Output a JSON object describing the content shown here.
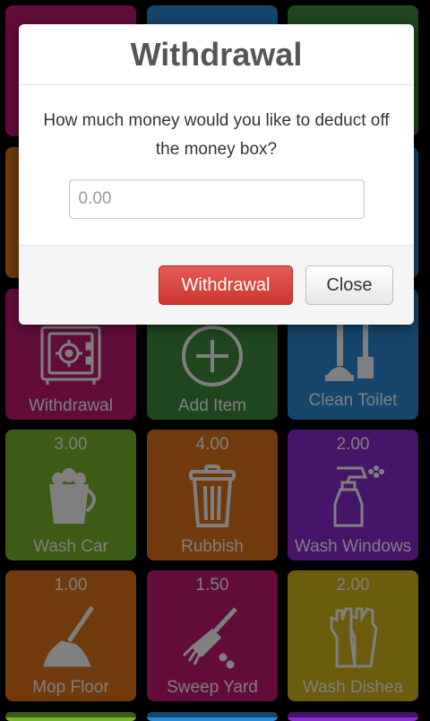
{
  "tiles": [
    {
      "price": "",
      "label": "",
      "color": "#c41979"
    },
    {
      "price": "",
      "label": "",
      "color": "#2a8bd6"
    },
    {
      "price": "",
      "label": "",
      "color": "#3e8c3a"
    },
    {
      "price": "",
      "label": "",
      "color": "#e2741a"
    },
    {
      "price": "",
      "label": "",
      "color": "#1b7e94"
    },
    {
      "price": "",
      "label": "",
      "color": "#2a8bd6"
    },
    {
      "price": "",
      "label": "Withdrawal",
      "color": "#c41979",
      "icon": "safe-icon"
    },
    {
      "price": "",
      "label": "Add Item",
      "color": "#3e8c3a",
      "icon": "plus-circle-icon"
    },
    {
      "price": "",
      "label": "Clean Toilet",
      "color": "#2a8bd6",
      "icon": "plunger-brush-icon"
    },
    {
      "price": "3.00",
      "label": "Wash Car",
      "color": "#78b62b",
      "icon": "bucket-icon"
    },
    {
      "price": "4.00",
      "label": "Rubbish",
      "color": "#e2741a",
      "icon": "trash-can-icon"
    },
    {
      "price": "2.00",
      "label": "Wash Windows",
      "color": "#8a2bd4",
      "icon": "spray-bottle-icon"
    },
    {
      "price": "1.00",
      "label": "Mop Floor",
      "color": "#e2741a",
      "icon": "mop-icon"
    },
    {
      "price": "1.50",
      "label": "Sweep Yard",
      "color": "#c41979",
      "icon": "broom-icon"
    },
    {
      "price": "2.00",
      "label": "Wash Dishea",
      "color": "#d8b81d",
      "icon": "gloves-icon"
    }
  ],
  "dialog": {
    "title": "Withdrawal",
    "question": "How much money would you like to deduct off the money box?",
    "amount_value": "",
    "amount_placeholder": "0.00",
    "withdraw_label": "Withdrawal",
    "close_label": "Close"
  }
}
